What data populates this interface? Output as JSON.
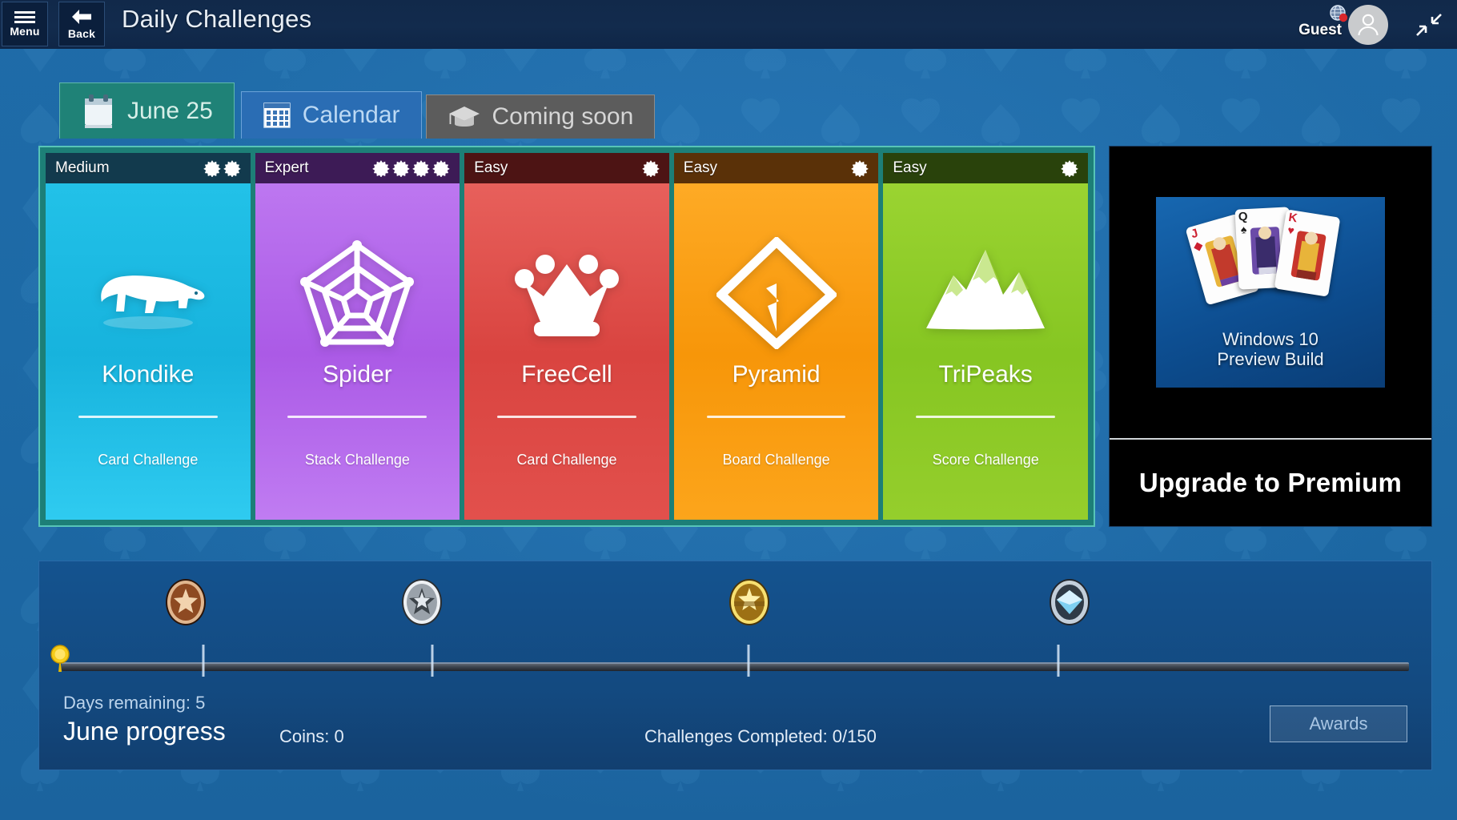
{
  "titlebar": {
    "menu_label": "Menu",
    "back_label": "Back",
    "page_title": "Daily Challenges",
    "account_name": "Guest",
    "menu_icon": "hamburger-icon",
    "back_icon": "back-arrow-icon",
    "avatar_icon": "person-avatar-icon",
    "badge_icon": "globe-notification-icon",
    "fullscreen_icon": "exit-fullscreen-icon",
    "bg": "#11294a"
  },
  "tabs": [
    {
      "label": "June 25",
      "icon": "calendar-page-icon",
      "active": true,
      "color": "#1f8277"
    },
    {
      "label": "Calendar",
      "icon": "calendar-grid-icon",
      "active": false,
      "color": "#2a6db4"
    },
    {
      "label": "Coming soon",
      "icon": "graduation-cap-icon",
      "active": false,
      "color": "#5c5c5c"
    }
  ],
  "challenges": {
    "panel_color": "#1d7f77",
    "cards": [
      {
        "title": "Klondike",
        "difficulty": "Medium",
        "stars": 2,
        "subtitle": "Card Challenge",
        "icon": "polar-bear-icon",
        "color": "#1cb6e0",
        "color_dark": "#12a4cf",
        "header_color": "#123a4d"
      },
      {
        "title": "Spider",
        "difficulty": "Expert",
        "stars": 4,
        "subtitle": "Stack Challenge",
        "icon": "spider-web-icon",
        "color": "#b061e8",
        "color_dark": "#a64fe0",
        "header_color": "#3d1b56"
      },
      {
        "title": "FreeCell",
        "difficulty": "Easy",
        "stars": 1,
        "subtitle": "Card Challenge",
        "icon": "crown-icon",
        "color": "#e04a49",
        "color_dark": "#d3403f",
        "header_color": "#4d1414"
      },
      {
        "title": "Pyramid",
        "difficulty": "Easy",
        "stars": 1,
        "subtitle": "Board Challenge",
        "icon": "pyramid-icon",
        "color": "#f89c11",
        "color_dark": "#f08f06",
        "header_color": "#5a3108"
      },
      {
        "title": "TriPeaks",
        "difficulty": "Easy",
        "stars": 1,
        "subtitle": "Score Challenge",
        "icon": "mountain-peaks-icon",
        "color": "#8dc92b",
        "color_dark": "#7dbd1f",
        "header_color": "#29420b"
      }
    ]
  },
  "premium": {
    "ad_line1": "Windows 10",
    "ad_line2": "Preview Build",
    "cta_label": "Upgrade to Premium",
    "cards": [
      {
        "rank": "J",
        "suit": "♦",
        "suit_name": "diamonds",
        "color": "#cc2030"
      },
      {
        "rank": "Q",
        "suit": "♠",
        "suit_name": "spades",
        "color": "#1c1c1c"
      },
      {
        "rank": "K",
        "suit": "♥",
        "suit_name": "hearts",
        "color": "#cc2030"
      }
    ]
  },
  "progress": {
    "days_remaining": "Days remaining: 5",
    "month_progress": "June progress",
    "coins": "Coins: 0",
    "challenges_completed": "Challenges Completed: 0/150",
    "awards_label": "Awards",
    "coin_marker_icon": "gold-coin-marker-icon",
    "medals": [
      {
        "name": "bronze-medal",
        "position_pct": 10.5,
        "rim": "#d8a275",
        "face": "#8a4420",
        "glow": "#e8b98f"
      },
      {
        "name": "silver-medal",
        "position_pct": 27.5,
        "rim": "#e6e8ea",
        "face": "#8e949b",
        "glow": "#f2f4f6"
      },
      {
        "name": "gold-medal",
        "position_pct": 51.0,
        "rim": "#f6e06a",
        "face": "#9a6d12",
        "glow": "#fff0a0"
      },
      {
        "name": "diamond-medal",
        "position_pct": 74.0,
        "rim": "#b9c6d2",
        "face": "#7ec8ea",
        "glow": "#dff2ff"
      }
    ]
  }
}
